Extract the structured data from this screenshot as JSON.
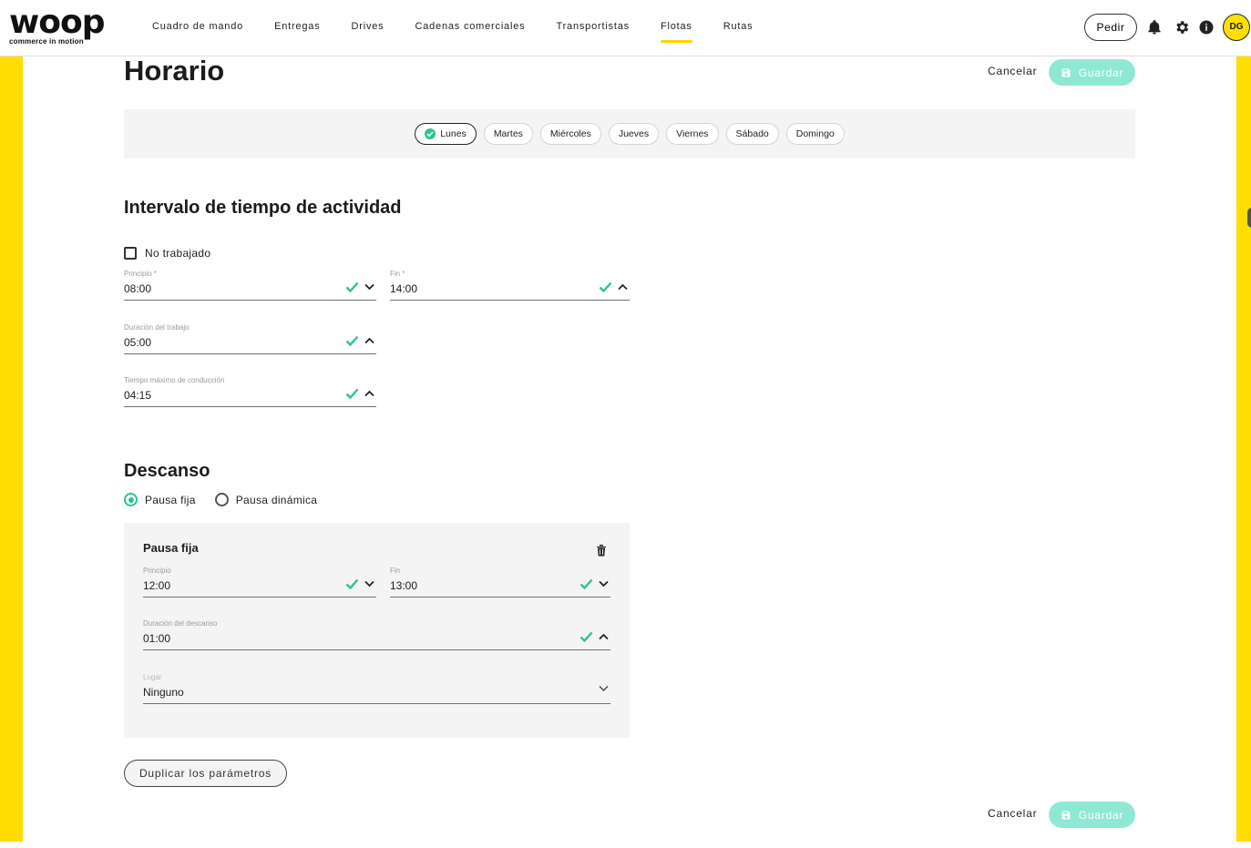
{
  "header": {
    "logo_word": "woop",
    "logo_tagline": "commerce in motion",
    "nav": [
      {
        "label": "Cuadro de mando"
      },
      {
        "label": "Entregas"
      },
      {
        "label": "Drives"
      },
      {
        "label": "Cadenas comerciales"
      },
      {
        "label": "Transportistas"
      },
      {
        "label": "Flotas"
      },
      {
        "label": "Rutas"
      }
    ],
    "active_nav": "Flotas",
    "order_button": "Pedir",
    "avatar_initials": "DG"
  },
  "page": {
    "title": "Horario",
    "cancel_label": "Cancelar",
    "save_label": "Guardar"
  },
  "days": [
    {
      "label": "Lunes",
      "selected": true
    },
    {
      "label": "Martes",
      "selected": false
    },
    {
      "label": "Miércoles",
      "selected": false
    },
    {
      "label": "Jueves",
      "selected": false
    },
    {
      "label": "Viernes",
      "selected": false
    },
    {
      "label": "Sábado",
      "selected": false
    },
    {
      "label": "Domingo",
      "selected": false
    }
  ],
  "activity": {
    "title": "Intervalo de tiempo de actividad",
    "not_worked_label": "No trabajado",
    "start": {
      "label": "Principio *",
      "value": "08:00"
    },
    "end": {
      "label": "Fin *",
      "value": "14:00"
    },
    "work_duration": {
      "label": "Duración del trabajo",
      "value": "05:00"
    },
    "max_driving": {
      "label": "Tiempo máximo de conducción",
      "value": "04:15"
    }
  },
  "rest": {
    "title": "Descanso",
    "option_fixed": "Pausa fija",
    "option_dynamic": "Pausa dinámica",
    "selected_option": "Pausa fija",
    "card": {
      "title": "Pausa fija",
      "start": {
        "label": "Principio",
        "value": "12:00"
      },
      "end": {
        "label": "Fin",
        "value": "13:00"
      },
      "duration": {
        "label": "Duración del descanso",
        "value": "01:00"
      },
      "place": {
        "label": "Lugar",
        "value": "Ninguno"
      }
    }
  },
  "duplicate_label": "Duplicar los parámetros",
  "colors": {
    "brand_yellow": "#ffdd00",
    "accent_green": "#2bc48a",
    "save_disabled": "#8fe8d3"
  }
}
